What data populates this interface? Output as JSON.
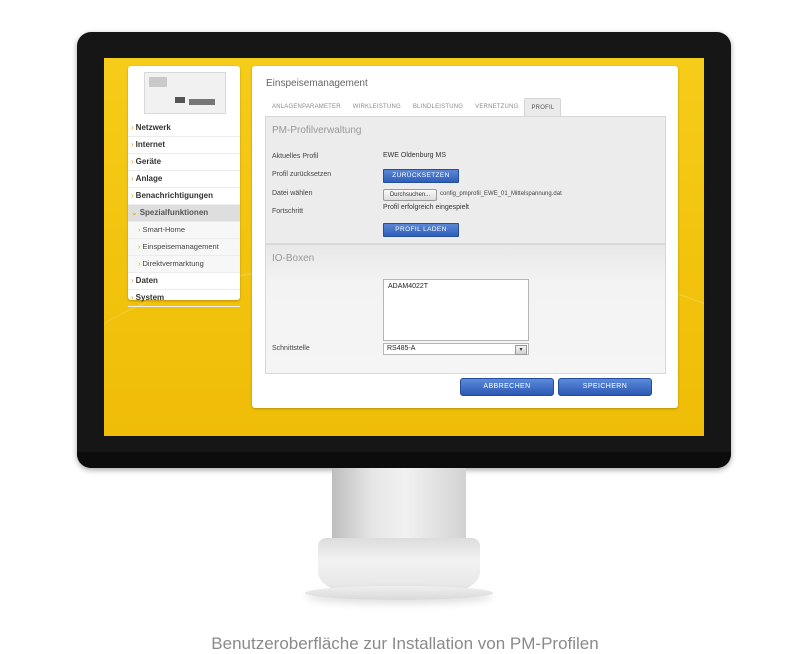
{
  "sidebar": {
    "items": [
      {
        "label": "Netzwerk"
      },
      {
        "label": "Internet"
      },
      {
        "label": "Geräte"
      },
      {
        "label": "Anlage"
      },
      {
        "label": "Benachrichtigungen"
      },
      {
        "label": "Spezialfunktionen",
        "active": true
      }
    ],
    "sub_items": [
      {
        "label": "Smart-Home"
      },
      {
        "label": "Einspeisemanagement"
      },
      {
        "label": "Direktvermarktung"
      }
    ],
    "items_after": [
      {
        "label": "Daten"
      },
      {
        "label": "System"
      }
    ]
  },
  "main": {
    "title": "Einspeisemanagement",
    "tabs": [
      {
        "label": "ANLAGENPARAMETER"
      },
      {
        "label": "WIRKLEISTUNG"
      },
      {
        "label": "BLINDLEISTUNG"
      },
      {
        "label": "VERNETZUNG"
      },
      {
        "label": "PROFIL",
        "active": true
      }
    ],
    "profile_section": {
      "title": "PM-Profilverwaltung",
      "current_profile_label": "Aktuelles Profil",
      "current_profile_value": "EWE Oldenburg MS",
      "reset_label": "Profil zurücksetzen",
      "reset_button": "ZURÜCKSETZEN",
      "file_label": "Datei wählen",
      "browse_button": "Durchsuchen...",
      "file_name": "config_pmprofil_EWE_01_Mittelspannung.dat",
      "progress_label": "Fortschritt",
      "progress_value": "Profil erfolgreich eingespielt",
      "load_button": "PROFIL LADEN"
    },
    "io_section": {
      "title": "IO-Boxen",
      "list_items": [
        "ADAM4022T"
      ],
      "interface_label": "Schnittstelle",
      "interface_value": "RS485-A"
    },
    "cancel_button": "ABBRECHEN",
    "save_button": "SPEICHERN"
  },
  "caption": "Benutzeroberfläche zur Installation von PM-Profilen",
  "colors": {
    "screen_background": "#f2c30d",
    "button_blue": "#2f5fb8",
    "bezel": "#161616"
  }
}
